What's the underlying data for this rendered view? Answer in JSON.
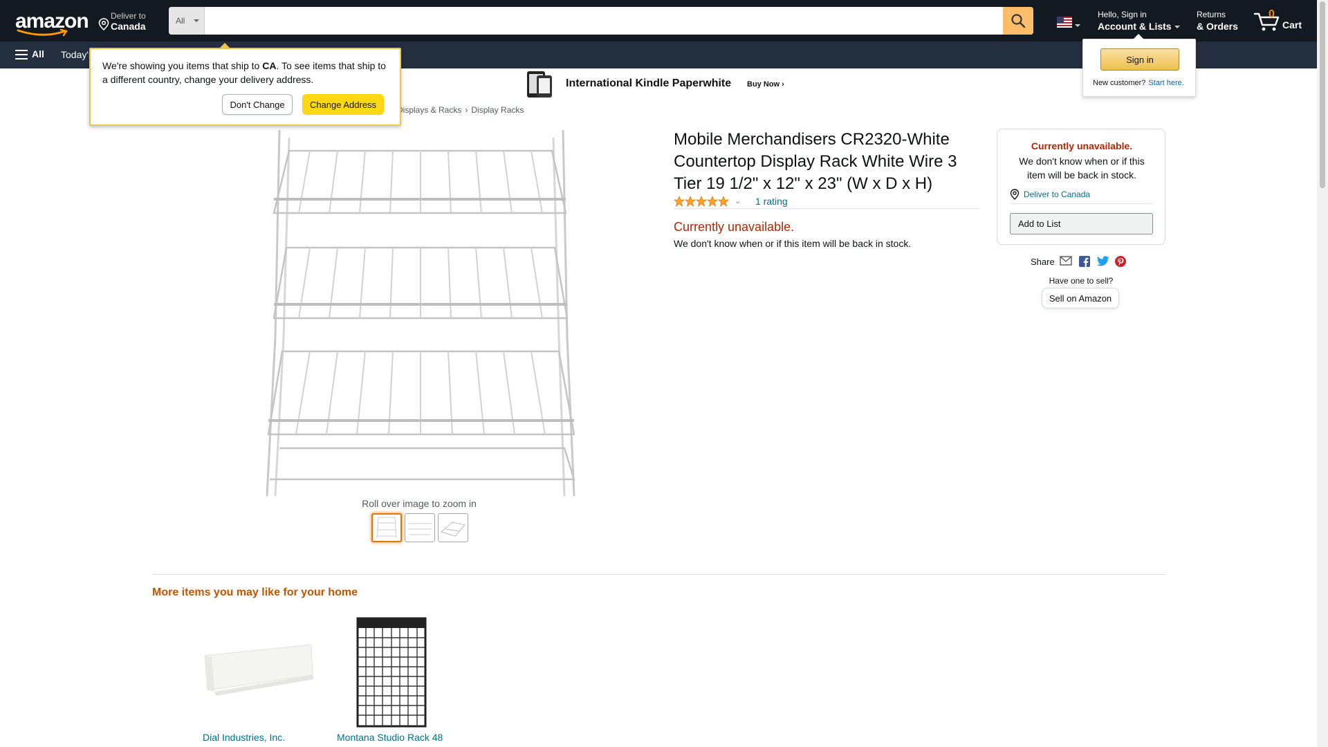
{
  "nav": {
    "logo_text": "amazon",
    "deliver_line1": "Deliver to",
    "deliver_line2": "Canada",
    "search_category": "All",
    "search_placeholder": "",
    "search_value": "",
    "account_line1": "Hello, Sign in",
    "account_line2": "Account & Lists",
    "returns_line1": "Returns",
    "returns_line2": "& Orders",
    "cart_count": "0",
    "cart_label": "Cart",
    "all_label": "All",
    "todays_label": "Today's"
  },
  "ship_popover": {
    "msg_part1": "We're showing you items that ship to ",
    "msg_country": "CA",
    "msg_part2": ". To see items that ship to a different country, change your delivery address.",
    "dont_change": "Don't Change",
    "change_address": "Change Address"
  },
  "signin_flyout": {
    "button": "Sign in",
    "new_customer": "New customer?",
    "start_here": "Start here."
  },
  "banner": {
    "title": "International Kindle Paperwhite",
    "cta": "Buy Now ›"
  },
  "breadcrumb": [
    "Displays & Racks",
    "Display Racks"
  ],
  "product": {
    "title": "Mobile Merchandisers CR2320-White Countertop Display Rack White Wire 3 Tier 19 1/2\" x 12\" x 23\" (W x D x H)",
    "rating_count": "1 rating",
    "stars": 5,
    "unavailable": "Currently unavailable.",
    "unavailable_sub": "We don't know when or if this item will be back in stock.",
    "zoom_hint": "Roll over image to zoom in",
    "thumbnails": 3
  },
  "buybox": {
    "unavailable": "Currently unavailable.",
    "unavailable_sub": "We don't know when or if this item will be back in stock.",
    "deliver": "Deliver to Canada",
    "add_to_list": "Add to List",
    "share_label": "Share",
    "have_one": "Have one to sell?",
    "sell": "Sell on Amazon"
  },
  "recommendations": {
    "heading": "More items you may like for your home",
    "items": [
      {
        "title": "Dial Industries, Inc."
      },
      {
        "title": "Montana Studio Rack 48"
      }
    ]
  },
  "colors": {
    "nav_bg": "#131921",
    "subnav_bg": "#232f3e",
    "search_button": "#febd69",
    "unavailable_red": "#b12704",
    "link_teal": "#007185",
    "heading_orange": "#c45500",
    "cart_count": "#f08804"
  }
}
